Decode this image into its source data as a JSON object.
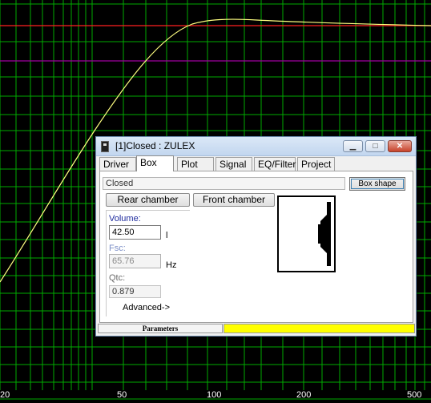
{
  "plot": {
    "background": "#000000",
    "grid_color": "#00aa00",
    "reference_line_color": "#ff2020",
    "secondary_line_color": "#a000a0",
    "curve_color": "#ffff80",
    "x_ticks": [
      "20",
      "50",
      "100",
      "200",
      "500"
    ]
  },
  "dialog": {
    "title": "[1]Closed : ZULEX",
    "tabs": [
      "Driver",
      "Box",
      "Plot",
      "Signal",
      "EQ/Filter",
      "Project"
    ],
    "active_tab": "Box",
    "box_name": "Closed",
    "box_shape_button": "Box shape",
    "rear_chamber_button": "Rear chamber",
    "front_chamber_button": "Front chamber",
    "volume": {
      "label": "Volume:",
      "value": "42.50",
      "unit": "l"
    },
    "fsc": {
      "label": "Fsc:",
      "value": "65.76",
      "unit": "Hz"
    },
    "qtc": {
      "label": "Qtc:",
      "value": "0.879"
    },
    "advanced_button": "Advanced->",
    "status": {
      "left_text": "Parameters",
      "right_color": "#ffff00"
    }
  }
}
